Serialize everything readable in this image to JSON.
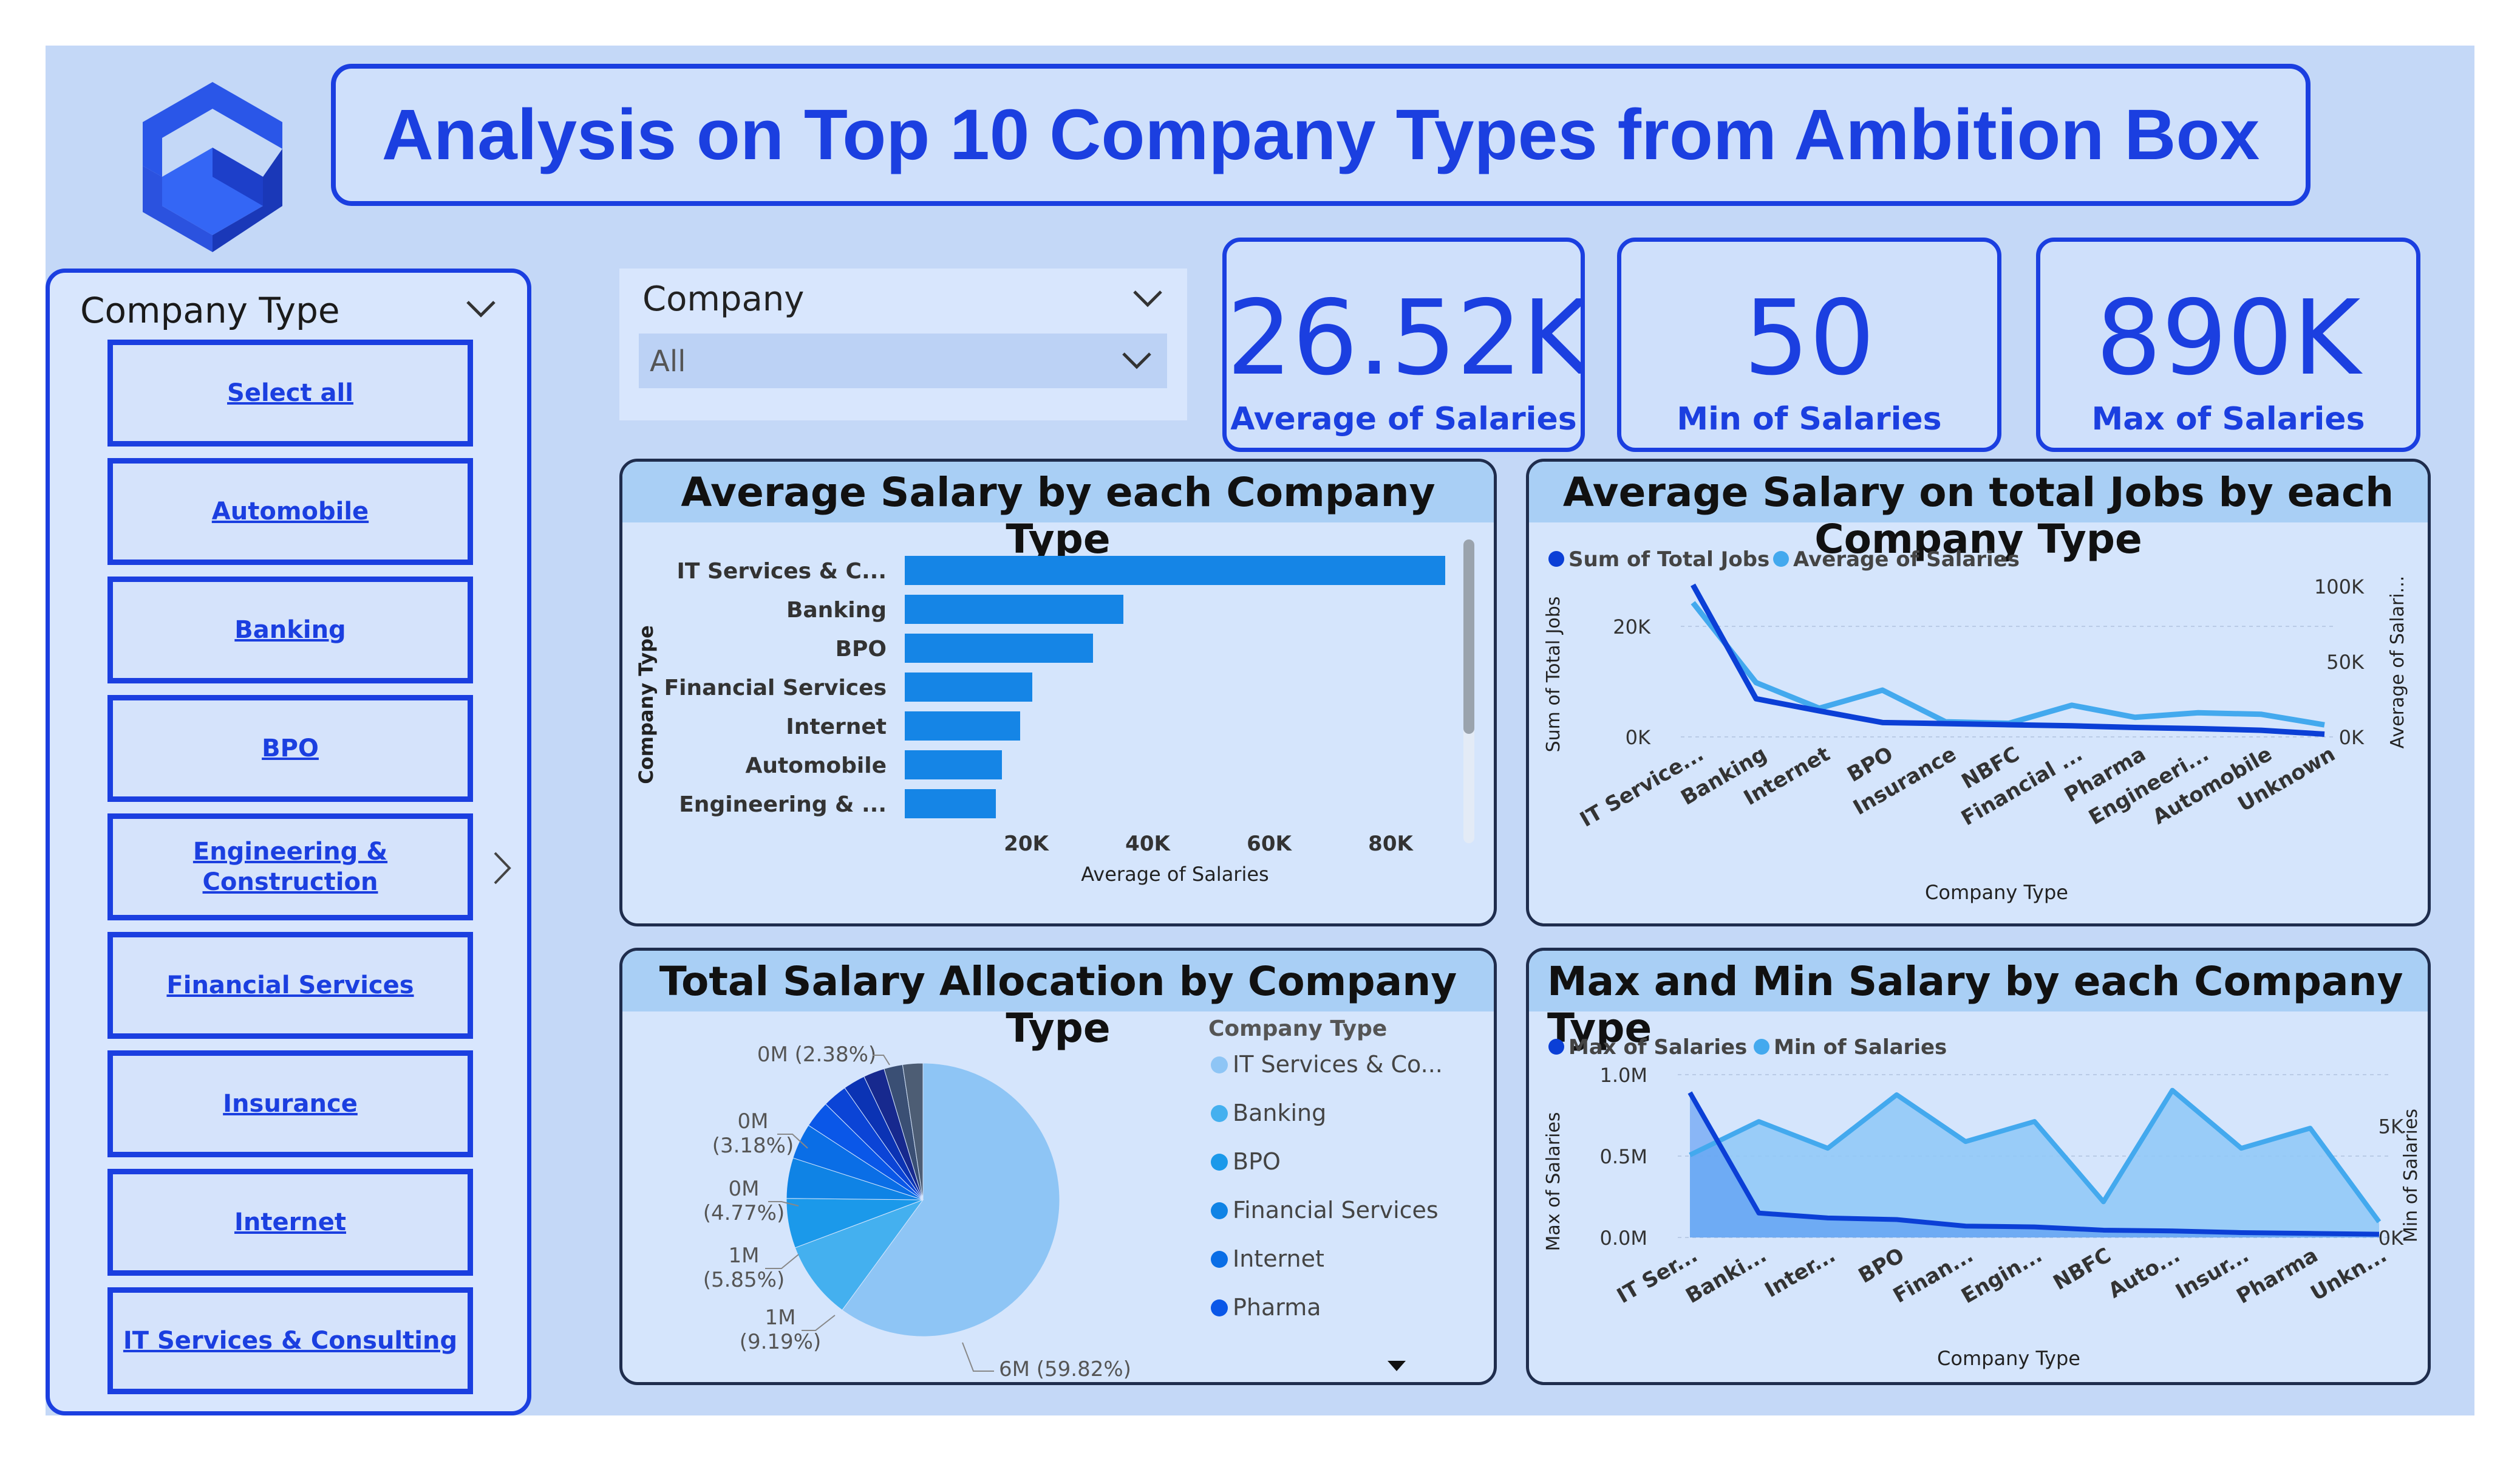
{
  "title": "Analysis on Top 10 Company Types from Ambition Box",
  "slicer": {
    "title": "Company Type",
    "items": [
      "Select all",
      "Automobile",
      "Banking",
      "BPO",
      "Engineering & Construction",
      "Financial Services",
      "Insurance",
      "Internet",
      "IT Services & Consulting"
    ]
  },
  "company_filter": {
    "label": "Company",
    "value": "All"
  },
  "kpis": [
    {
      "value": "26.52K",
      "label": "Average of Salaries"
    },
    {
      "value": "50",
      "label": "Min of Salaries"
    },
    {
      "value": "890K",
      "label": "Max of Salaries"
    }
  ],
  "colors": {
    "accent": "#1b3fe0",
    "background": "#c4d8f7",
    "bar": "#1585e6",
    "dark_series": "#0b3fd6",
    "light_series": "#43a9ee"
  },
  "chart_data": [
    {
      "type": "bar",
      "title": "Average Salary by each Company Type",
      "orientation": "horizontal",
      "categories": [
        "IT Services & C...",
        "Banking",
        "BPO",
        "Financial Services",
        "Internet",
        "Automobile",
        "Engineering & ..."
      ],
      "values": [
        89000,
        36000,
        31000,
        21000,
        19000,
        16000,
        15000
      ],
      "xlabel": "Average of Salaries",
      "ylabel": "Company Type",
      "xticks": [
        "20K",
        "40K",
        "60K",
        "80K"
      ],
      "xtick_values": [
        20000,
        40000,
        60000,
        80000
      ],
      "xlim": [
        0,
        89000
      ]
    },
    {
      "type": "line",
      "title": "Average Salary on total Jobs by each Company Type",
      "categories": [
        "IT Service...",
        "Banking",
        "Internet",
        "BPO",
        "Insurance",
        "NBFC",
        "Financial ...",
        "Pharma",
        "Engineeri...",
        "Automobile",
        "Unknown"
      ],
      "series": [
        {
          "name": "Sum of Total Jobs",
          "axis": "left",
          "values": [
            27500,
            6900,
            4700,
            2600,
            2400,
            2200,
            2000,
            1700,
            1500,
            1200,
            500
          ]
        },
        {
          "name": "Average of Salaries",
          "axis": "right",
          "values": [
            89000,
            36000,
            19000,
            31000,
            10000,
            9000,
            21000,
            13000,
            16000,
            15000,
            8000
          ]
        }
      ],
      "xlabel": "Company Type",
      "ylabel_left": "Sum of Total Jobs",
      "ylabel_right": "Average of Salari...",
      "yticks_left": [
        "0K",
        "20K"
      ],
      "yticks_left_values": [
        0,
        20000
      ],
      "yticks_right": [
        "0K",
        "50K",
        "100K"
      ],
      "yticks_right_values": [
        0,
        50000,
        100000
      ],
      "ylim_left": [
        0,
        30000
      ],
      "ylim_right": [
        0,
        110000
      ],
      "legend": "top-left"
    },
    {
      "type": "pie",
      "title": "Total Salary Allocation by Company Type",
      "legend_title": "Company Type",
      "legend": [
        "IT Services & Co...",
        "Banking",
        "BPO",
        "Financial Services",
        "Internet",
        "Pharma"
      ],
      "slices": [
        {
          "label": "6M (59.82%)",
          "percent": 59.82
        },
        {
          "label": "1M (9.19%)",
          "percent": 9.19
        },
        {
          "label": "1M (5.85%)",
          "percent": 5.85
        },
        {
          "label": "0M (4.77%)",
          "percent": 4.77
        },
        {
          "label": "",
          "percent": 4.2
        },
        {
          "label": "0M (3.18%)",
          "percent": 3.18
        },
        {
          "label": "",
          "percent": 2.9
        },
        {
          "label": "",
          "percent": 2.6
        },
        {
          "label": "",
          "percent": 2.5
        },
        {
          "label": "",
          "percent": 2.2
        },
        {
          "label": "0M (2.38%)",
          "percent": 2.38
        }
      ]
    },
    {
      "type": "area",
      "title": "Max and Min Salary by each Company Type",
      "categories": [
        "IT Ser...",
        "Banki...",
        "Inter...",
        "BPO",
        "Finan...",
        "Engin...",
        "NBFC",
        "Auto...",
        "Insur...",
        "Pharma",
        "Unkn..."
      ],
      "series": [
        {
          "name": "Max of Salaries",
          "axis": "left",
          "values": [
            890000,
            150000,
            120000,
            110000,
            70000,
            65000,
            45000,
            40000,
            30000,
            25000,
            20000
          ]
        },
        {
          "name": "Min of Salaries",
          "axis": "right",
          "values": [
            3700,
            5200,
            4000,
            6400,
            4300,
            5200,
            1600,
            6600,
            4000,
            4900,
            700
          ]
        }
      ],
      "xlabel": "Company Type",
      "ylabel_left": "Max of Salaries",
      "ylabel_right": "Min of Salaries",
      "yticks_left": [
        "0.0M",
        "0.5M",
        "1.0M"
      ],
      "yticks_left_values": [
        0,
        500000,
        1000000
      ],
      "yticks_right": [
        "0K",
        "5K"
      ],
      "yticks_right_values": [
        0,
        5000
      ],
      "ylim_left": [
        0,
        1000000
      ],
      "ylim_right": [
        0,
        7300
      ],
      "legend": "top-left"
    }
  ]
}
